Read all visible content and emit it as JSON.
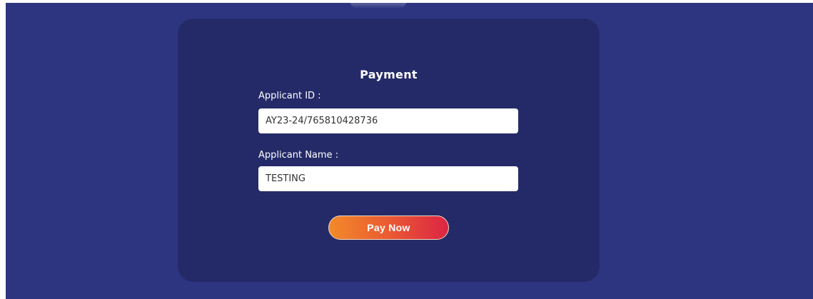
{
  "form": {
    "title": "Payment",
    "applicant_id_label": "Applicant ID :",
    "applicant_id_value": "AY23-24/765810428736",
    "applicant_name_label": "Applicant Name :",
    "applicant_name_value": "TESTING",
    "pay_button_label": "Pay Now"
  },
  "colors": {
    "page_background": "#2e3580",
    "card_background": "#242a68",
    "button_gradient_start": "#f28a2a",
    "button_gradient_end": "#dc2444"
  }
}
